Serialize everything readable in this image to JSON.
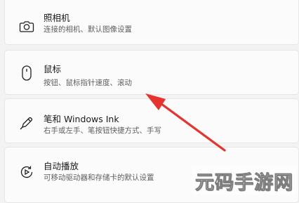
{
  "settings": [
    {
      "id": "camera",
      "title": "照相机",
      "description": "连接的相机、默认图像设置",
      "icon": "camera-icon"
    },
    {
      "id": "mouse",
      "title": "鼠标",
      "description": "按钮、鼠标指针速度、滚动",
      "icon": "mouse-icon"
    },
    {
      "id": "pen",
      "title": "笔和 Windows Ink",
      "description": "右手或左手、笔按钮快捷方式、手写",
      "icon": "pen-icon"
    },
    {
      "id": "autoplay",
      "title": "自动播放",
      "description": "可移动驱动器和存储卡的默认设置",
      "icon": "autoplay-icon"
    }
  ],
  "annotation": {
    "arrow_color": "#e8322d"
  },
  "watermark": {
    "text": "元码手游网"
  }
}
